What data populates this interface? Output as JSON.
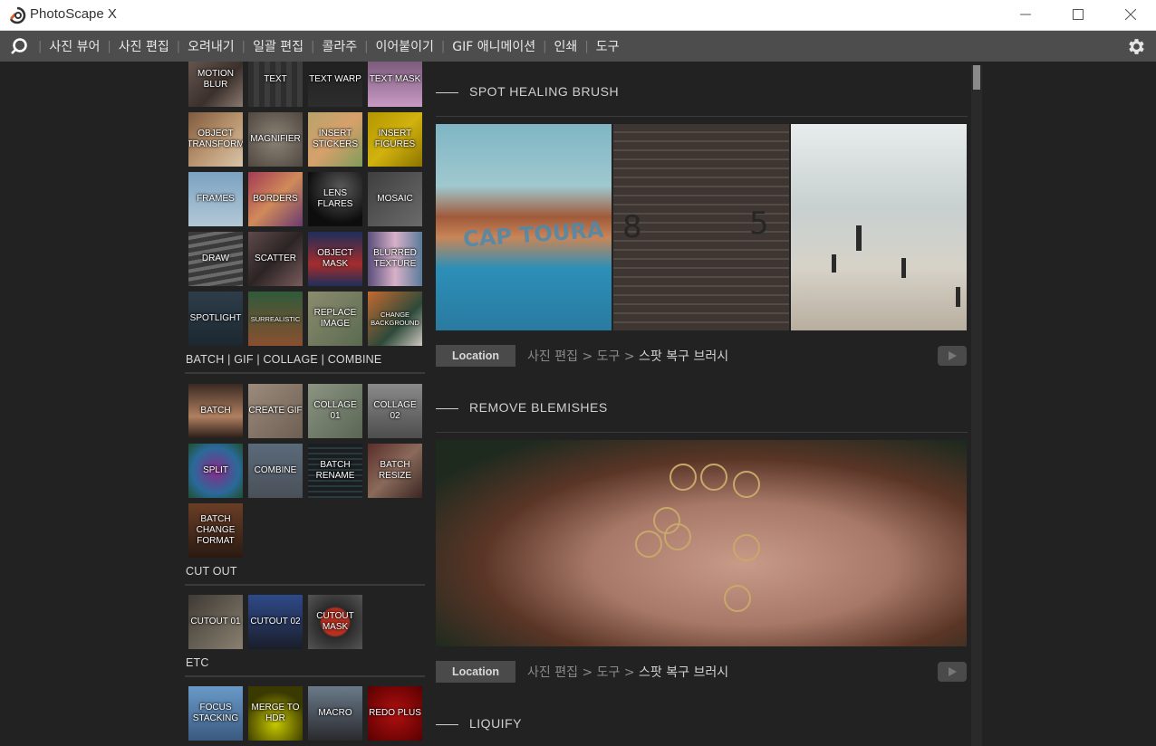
{
  "window": {
    "title": "PhotoScape X",
    "controls": {
      "minimize_icon": "minimize-icon",
      "maximize_icon": "maximize-icon",
      "close_icon": "close-icon"
    }
  },
  "menu": {
    "items": [
      "사진 뷰어",
      "사진 편집",
      "오려내기",
      "일괄 편집",
      "콜라주",
      "이어붙이기",
      "GIF 애니메이션",
      "인쇄",
      "도구"
    ]
  },
  "tools": {
    "row1": [
      "MOTION BLUR",
      "TEXT",
      "TEXT WARP",
      "TEXT MASK"
    ],
    "row2": [
      "OBJECT TRANSFORM",
      "MAGNIFIER",
      "INSERT STICKERS",
      "INSERT FIGURES"
    ],
    "row3": [
      "FRAMES",
      "BORDERS",
      "LENS FLARES",
      "MOSAIC"
    ],
    "row4": [
      "DRAW",
      "SCATTER",
      "OBJECT MASK",
      "BLURRED TEXTURE"
    ],
    "row5": [
      "SPOTLIGHT",
      "SURREALISTIC",
      "REPLACE IMAGE",
      "CHANGE BACKGROUND"
    ]
  },
  "sections": {
    "batch": {
      "title": "BATCH | GIF | COLLAGE | COMBINE",
      "tiles": [
        "BATCH",
        "CREATE GIF",
        "COLLAGE 01",
        "COLLAGE 02",
        "SPLIT",
        "COMBINE",
        "BATCH RENAME",
        "BATCH RESIZE",
        "BATCH CHANGE FORMAT"
      ]
    },
    "cutout": {
      "title": "CUT OUT",
      "tiles": [
        "CUTOUT 01",
        "CUTOUT 02",
        "CUTOUT MASK"
      ]
    },
    "etc": {
      "title": "ETC",
      "tiles": [
        "FOCUS STACKING",
        "MERGE TO HDR",
        "MACRO",
        "REDO PLUS"
      ]
    }
  },
  "features": [
    {
      "title": "SPOT HEALING BRUSH",
      "location_label": "Location",
      "path": [
        "사진 편집",
        ">",
        "도구",
        ">",
        "스팟 복구 브러시"
      ],
      "photo_text": [
        "CAP TOURA",
        "8",
        "5"
      ]
    },
    {
      "title": "REMOVE BLEMISHES",
      "location_label": "Location",
      "path": [
        "사진 편집",
        ">",
        "도구",
        ">",
        "스팟 복구 브러시"
      ]
    },
    {
      "title": "LIQUIFY"
    }
  ],
  "colors": {
    "titlebar": "#ffffff",
    "menubar": "#4d4d4d",
    "background": "#222222",
    "accent_orange": "#e0541f"
  }
}
